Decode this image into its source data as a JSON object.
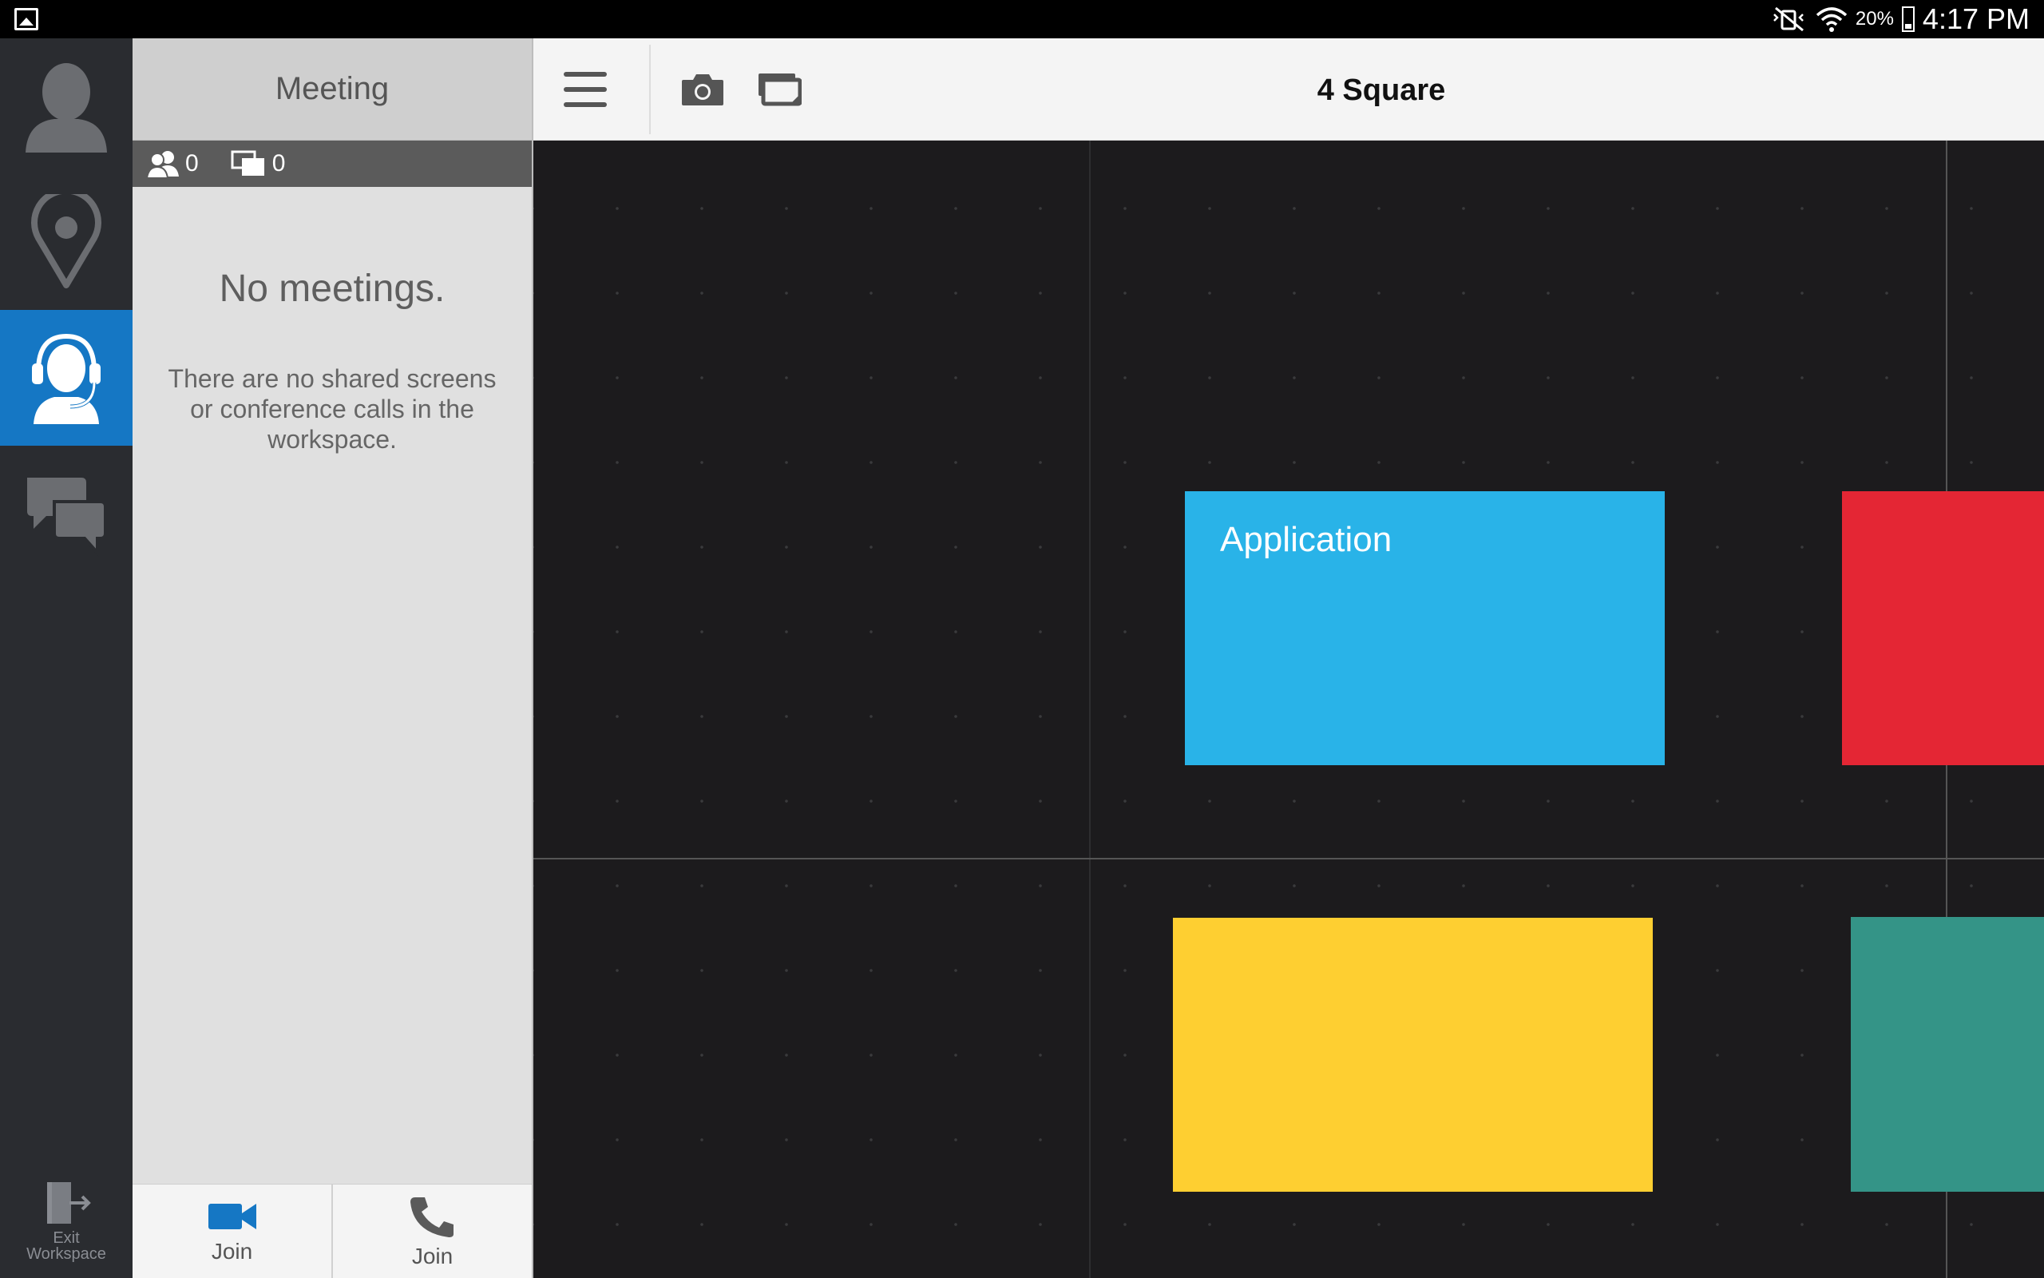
{
  "status_bar": {
    "battery_percent": "20%",
    "time": "4:17 PM"
  },
  "rail": {
    "items": [
      {
        "name": "profile",
        "icon": "person-icon"
      },
      {
        "name": "location",
        "icon": "map-pin-icon"
      },
      {
        "name": "meeting",
        "icon": "headset-icon",
        "active": true
      },
      {
        "name": "chat",
        "icon": "chat-bubbles-icon"
      }
    ],
    "exit_label_line1": "Exit",
    "exit_label_line2": "Workspace"
  },
  "panel": {
    "title": "Meeting",
    "participants_count": "0",
    "screens_count": "0",
    "empty_title": "No meetings.",
    "empty_description": "There are no shared screens or conference calls in the workspace.",
    "footer": {
      "video_join_label": "Join",
      "phone_join_label": "Join"
    }
  },
  "toolbar": {
    "workspace_title": "4 Square"
  },
  "canvas": {
    "notes": [
      {
        "name": "application-note",
        "label": "Application",
        "color": "#29b3e8"
      },
      {
        "name": "red-note",
        "label": "",
        "color": "#e42634"
      },
      {
        "name": "yellow-note",
        "label": "",
        "color": "#fecf31"
      },
      {
        "name": "teal-note",
        "label": "",
        "color": "#349487"
      }
    ]
  },
  "colors": {
    "accent": "#1577c4",
    "rail_bg": "#2a2c30",
    "canvas_bg": "#1c1b1d"
  }
}
